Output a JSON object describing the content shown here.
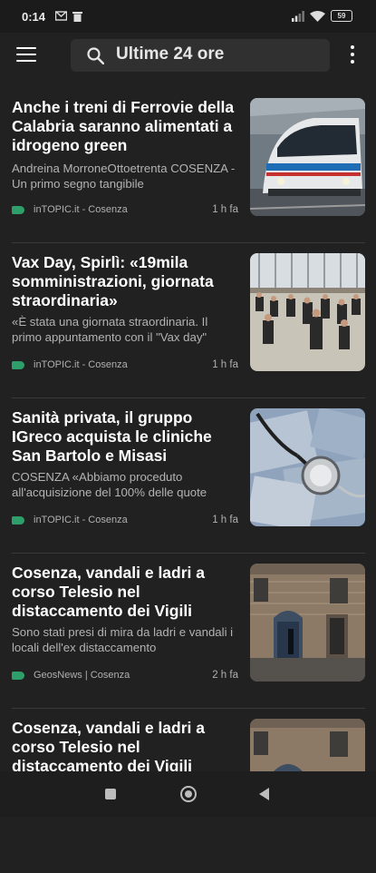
{
  "status": {
    "time": "0:14",
    "battery": "59"
  },
  "search": {
    "text": "Ultime 24 ore"
  },
  "articles": [
    {
      "title": "Anche i treni di Ferrovie della Calabria saranno alimentati a idrogeno green",
      "snippet": "Andreina MorroneOttoetrenta COSENZA - Un primo segno tangibile",
      "source": "inTOPIC.it - Cosenza",
      "time": "1 h fa"
    },
    {
      "title": "Vax Day, Spirlì: «19mila somministrazioni, giornata straordinaria»",
      "snippet": "«È stata una giornata straordinaria. Il primo appuntamento con il \"Vax day\"",
      "source": "inTOPIC.it - Cosenza",
      "time": "1 h fa"
    },
    {
      "title": "Sanità privata, il gruppo IGreco acquista le cliniche San Bartolo e Misasi",
      "snippet": "COSENZA «Abbiamo proceduto all'acquisizione del 100% delle quote",
      "source": "inTOPIC.it - Cosenza",
      "time": "1 h fa"
    },
    {
      "title": "Cosenza, vandali e ladri a corso Telesio nel distaccamento dei Vigili",
      "snippet": "Sono stati presi di mira da ladri e vandali i locali dell'ex distaccamento",
      "source": "GeosNews | Cosenza",
      "time": "2 h fa"
    },
    {
      "title": "Cosenza, vandali e ladri a corso Telesio nel distaccamento dei Vigili",
      "snippet": "",
      "source": "",
      "time": ""
    }
  ]
}
